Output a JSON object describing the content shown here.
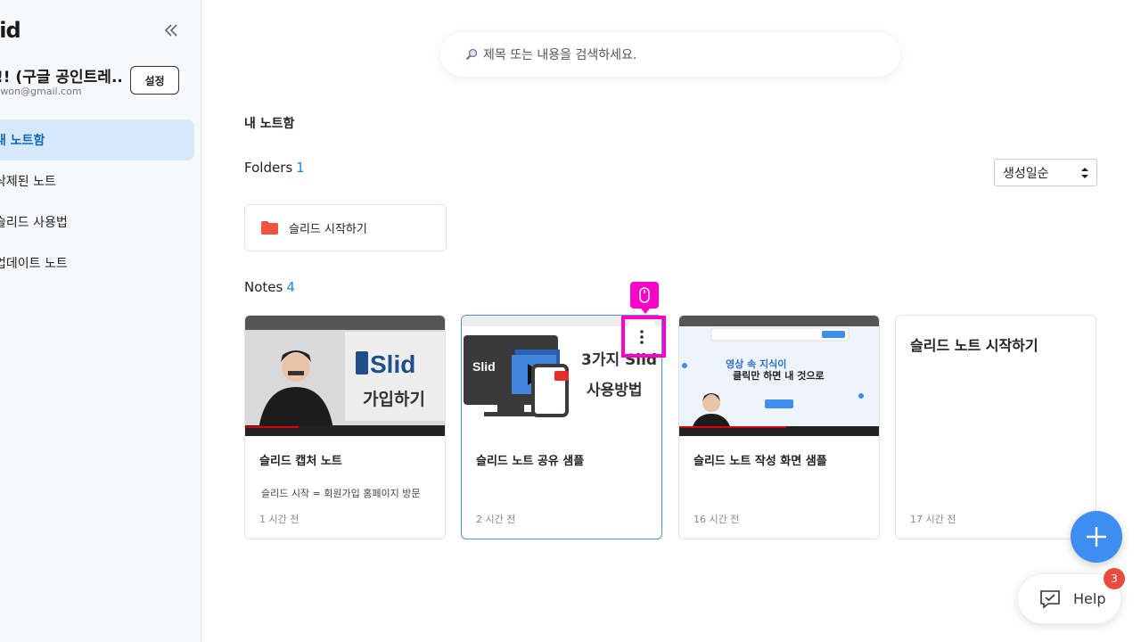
{
  "sidebar": {
    "logo": "lid",
    "profile_name": "!! (구글 공인트레...",
    "profile_email": "twon@gmail.com",
    "settings_label": "설정",
    "items": [
      {
        "label": "내 노트함"
      },
      {
        "label": "삭제된 노트"
      },
      {
        "label": "슬리드 사용법"
      },
      {
        "label": "업데이트 노트"
      }
    ]
  },
  "search": {
    "placeholder": "제목 또는 내용을 검색하세요."
  },
  "main": {
    "section_title": "내 노트함",
    "folders_label": "Folders",
    "folders_count": "1",
    "sort_value": "생성일순",
    "folders": [
      {
        "name": "슬리드 시작하기"
      }
    ],
    "notes_label": "Notes",
    "notes_count": "4",
    "notes": [
      {
        "title": "슬리드 캡처 노트",
        "snippet": "슬리드 시작 = 회원가입 홈페이지 방문",
        "time": "1 시간 전",
        "thumb_text_1": "Slid",
        "thumb_text_2": "가입하기"
      },
      {
        "title": "슬리드 노트 공유 샘플",
        "snippet": "",
        "time": "2 시간 전",
        "thumb_text_1": "Slid",
        "thumb_text_2": "3가지 Slid",
        "thumb_text_3": "사용방법"
      },
      {
        "title": "슬리드 노트 작성 화면 샘플",
        "snippet": "",
        "time": "16 시간 전",
        "thumb_text_1": "영상 속 지식이",
        "thumb_text_2": "클릭만 하면 내 것으로"
      },
      {
        "title": "슬리드 노트 시작하기",
        "snippet": "",
        "time": "17 시간 전"
      }
    ]
  },
  "help": {
    "label": "Help",
    "badge": "3"
  },
  "colors": {
    "accent": "#3d8ef0",
    "highlight": "#ff00c8",
    "folder": "#f0533e"
  }
}
